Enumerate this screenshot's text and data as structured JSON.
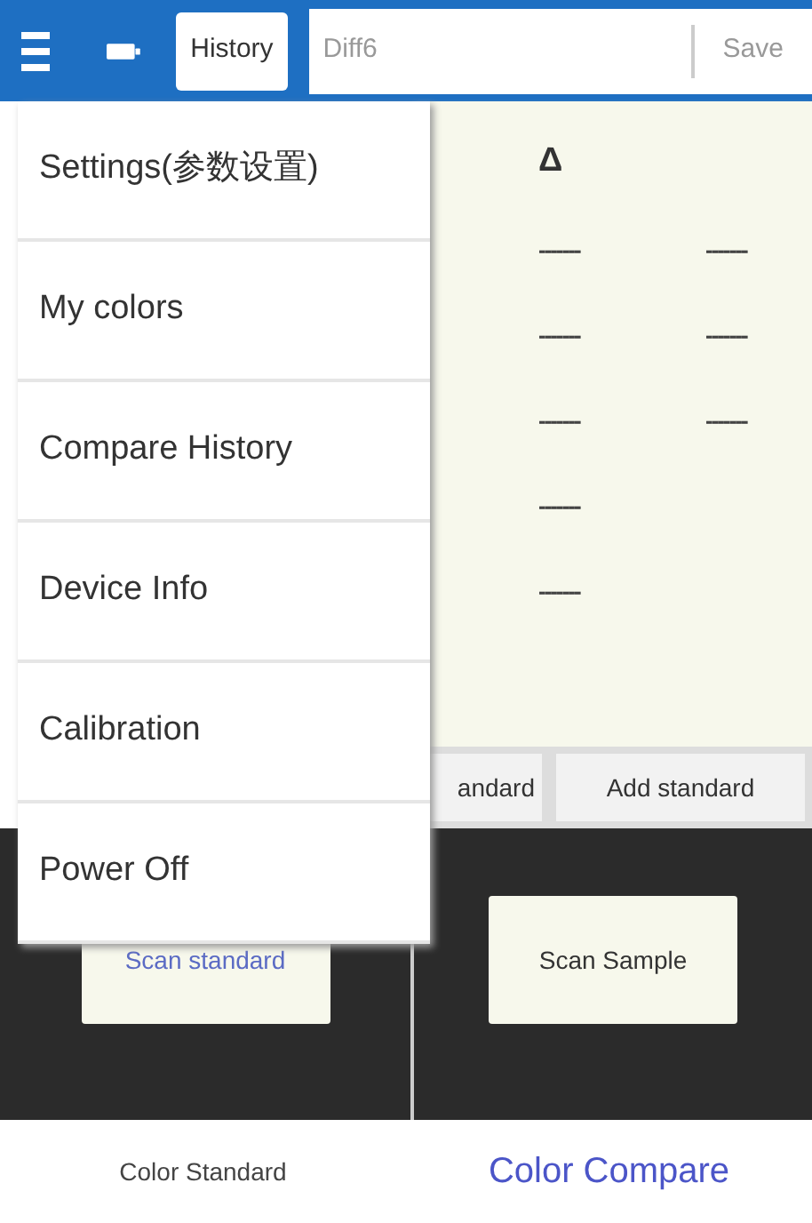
{
  "toolbar": {
    "history_button": "History",
    "name_field": {
      "placeholder": "Diff6"
    },
    "save_button": "Save"
  },
  "table": {
    "header": "Δ",
    "rows": [
      [
        "-------",
        "-------"
      ],
      [
        "-------",
        "-------"
      ],
      [
        "-------",
        "-------"
      ],
      [
        "-------"
      ],
      [
        "-------"
      ]
    ]
  },
  "standard_buttons": [
    "andard",
    "Add standard"
  ],
  "scan_panels": [
    {
      "label": "Scan standard",
      "selected": true
    },
    {
      "label": "Scan Sample",
      "selected": false
    }
  ],
  "menu": {
    "items": [
      "Settings(参数设置)",
      "My colors",
      "Compare History",
      "Device Info",
      "Calibration",
      "Power Off"
    ]
  },
  "bottom_tabs": [
    {
      "label": "Color Standard",
      "selected": false
    },
    {
      "label": "Color Compare",
      "selected": true
    }
  ]
}
